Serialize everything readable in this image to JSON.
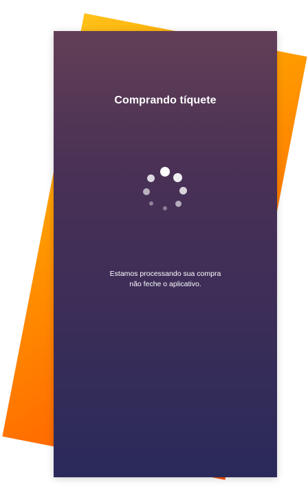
{
  "loading_screen": {
    "title": "Comprando tíquete",
    "message_line1": "Estamos processando sua compra",
    "message_line2": "não feche o aplicativo.",
    "spinner_icon": "loading-spinner-icon"
  },
  "colors": {
    "phone_gradient_top": "#623f57",
    "phone_gradient_bottom": "#2a2a5a",
    "backdrop_orange": "#ff7a00",
    "backdrop_yellow": "#ffc21a",
    "text": "#ffffff"
  }
}
